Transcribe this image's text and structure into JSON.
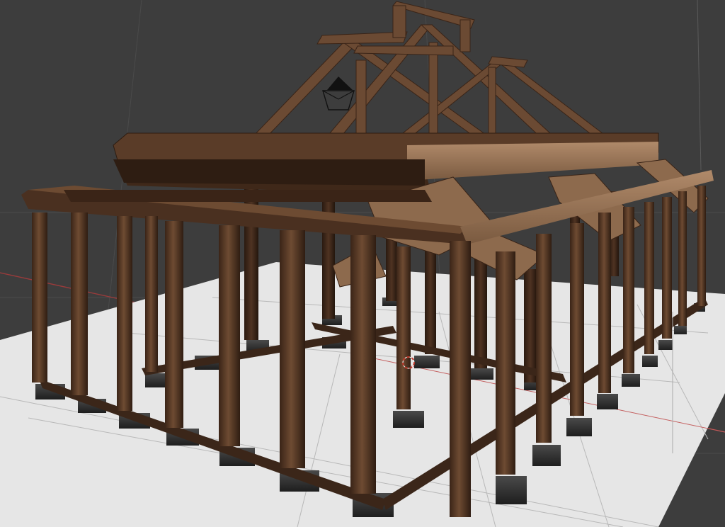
{
  "viewport": {
    "kind": "3d-viewport",
    "background": "#3d3d3d",
    "grid_color": "#4a4a4a",
    "x_axis_color": "#9a3b3b",
    "y_axis_color": "#5d8a3a"
  },
  "scene_objects": [
    {
      "name": "ground-plane",
      "color": "#e6e6e6",
      "selected": false
    },
    {
      "name": "timber-frame-house",
      "material": "wood",
      "color": "#6b4a33",
      "selected": false
    },
    {
      "name": "stone-footings",
      "color": "#333333",
      "selected": false
    },
    {
      "name": "camera",
      "icon": "camera-icon",
      "selected": false
    },
    {
      "name": "3d-cursor",
      "icon": "cursor-icon",
      "color": "#c0392b"
    }
  ]
}
